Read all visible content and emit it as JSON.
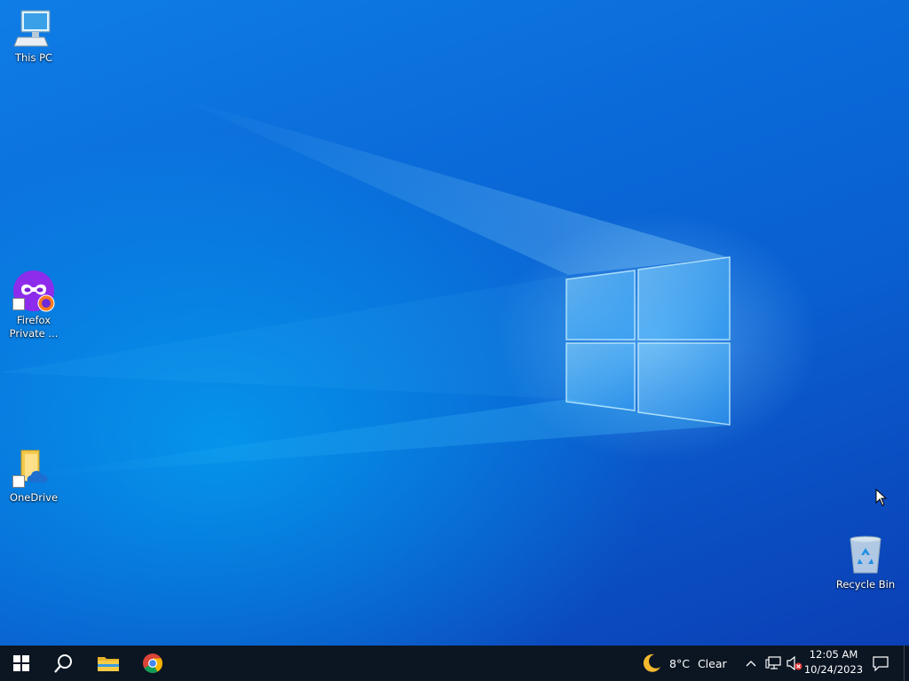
{
  "desktop": {
    "icons": [
      {
        "label": "This PC",
        "icon": "computer-icon"
      },
      {
        "label_line1": "Firefox",
        "label_line2": "Private ...",
        "icon": "firefox-private-icon"
      },
      {
        "label": "OneDrive",
        "icon": "onedrive-folder-icon"
      },
      {
        "label": "Recycle Bin",
        "icon": "recycle-bin-icon"
      }
    ],
    "colors": {
      "wallpaper_primary": "#0a6ad8",
      "wallpaper_dark": "#0b3fb5",
      "logo_glow": "#7fd0ff"
    }
  },
  "taskbar": {
    "background": "#0c1623",
    "start_icon": "windows-start-icon",
    "search_icon": "search-icon",
    "pinned": [
      {
        "name": "File Explorer",
        "icon": "file-explorer-icon"
      },
      {
        "name": "Google Chrome",
        "icon": "chrome-icon"
      }
    ],
    "weather": {
      "icon": "moon-icon",
      "temperature": "8°C",
      "condition": "Clear"
    },
    "tray_icons": [
      "chevron-up-icon",
      "network-icon",
      "volume-muted-icon"
    ],
    "clock": {
      "time": "12:05 AM",
      "date": "10/24/2023"
    },
    "notifications_icon": "notification-icon"
  }
}
